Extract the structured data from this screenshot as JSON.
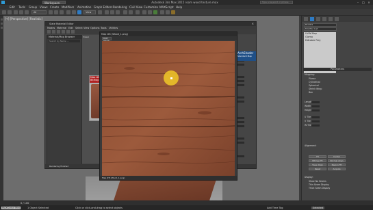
{
  "app": {
    "title": "Autodesk 3ds Max 2015   room wood texture.max",
    "workspace": "Workspace: Default",
    "search_placeholder": "Type a keyword or phrase"
  },
  "menus": [
    "Edit",
    "Tools",
    "Group",
    "Views",
    "Create",
    "Modifiers",
    "Animation",
    "Graph Editors",
    "Rendering",
    "Civil View",
    "Customize",
    "MAXScript",
    "Help"
  ],
  "toolbar": {
    "selection_filter": "All",
    "ref_coord": "View"
  },
  "viewport": {
    "label": "[+] [Perspective] [Realistic]"
  },
  "slate": {
    "title": "Slate Material Editor",
    "menus": [
      "Modes",
      "Material",
      "Edit",
      "Select",
      "View",
      "Options",
      "Tools",
      "Utilities"
    ],
    "browser_title": "Material/Map Browser",
    "browser_search": "Search by Name ...",
    "view_label": "View1",
    "node_title": "Map #8 Bitmap",
    "side_node_title": "ArchShader",
    "side_node_sub": "Standard Map",
    "status": "Rendering finished"
  },
  "bitmap_window": {
    "title": "Map #8 (Wood_1.png)",
    "dropdown": "RGB Alpha",
    "footer": "Map #8 (Wood_1.png)"
  },
  "command_panel": {
    "object_name": "Box001",
    "modifier_list": "Modifier List",
    "stack": [
      "UVW Map",
      "Gizmo",
      "Editable Poly"
    ],
    "rollout": "Parameters",
    "mapping_label": "Mapping:",
    "mapping_options": [
      "Planar",
      "Cylindrical",
      "Spherical",
      "Shrink Wrap",
      "Box"
    ],
    "fields": [
      "Length:",
      "Width:",
      "Height:"
    ],
    "tile_labels": [
      "U Tile:",
      "V Tile:",
      "W Tile:"
    ],
    "buttons": [
      "Fit",
      "Center",
      "Bitmap Fit",
      "Normal Align",
      "View Align",
      "Region Fit",
      "Reset",
      "Acquire"
    ],
    "alignment_label": "Alignment:",
    "display_label": "Display:",
    "display_options": [
      "Show No Seams",
      "Thin Seam Display",
      "Thick Seam Display"
    ]
  },
  "status": {
    "selected": "1 Object Selected",
    "prompt": "Click or click-and-drag to select objects",
    "script": "MAXScript Mini",
    "frame": "0 / 100",
    "add_time_tag": "Add Time Tag",
    "set_key": "Selected"
  }
}
